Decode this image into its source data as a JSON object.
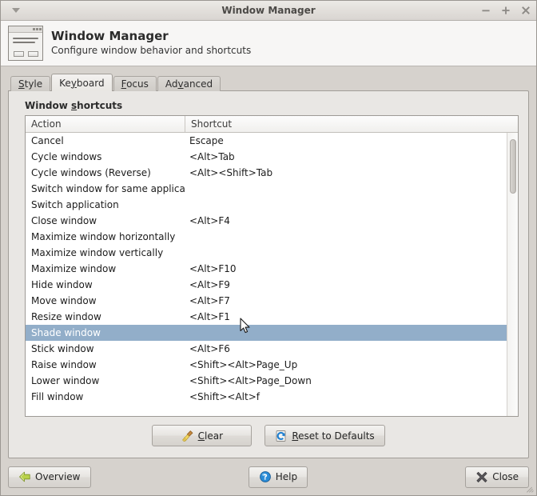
{
  "window": {
    "title": "Window Manager",
    "menu_icon": "chevron-down-icon",
    "minimize_label": "−",
    "maximize_label": "+",
    "close_label": "×"
  },
  "banner": {
    "icon": "window-manager-icon",
    "title": "Window Manager",
    "subtitle": "Configure window behavior and shortcuts"
  },
  "tabs": [
    {
      "label": "Style",
      "mnemonic": "S",
      "active": false
    },
    {
      "label": "Keyboard",
      "mnemonic": "y",
      "active": true
    },
    {
      "label": "Focus",
      "mnemonic": "F",
      "active": false
    },
    {
      "label": "Advanced",
      "mnemonic": "v",
      "active": false
    }
  ],
  "frame": {
    "label_pre": "Window ",
    "label_mnemonic": "s",
    "label_post": "hortcuts"
  },
  "table": {
    "columns": [
      "Action",
      "Shortcut"
    ],
    "selected_index": 12,
    "rows": [
      {
        "action": "Cancel",
        "shortcut": "Escape"
      },
      {
        "action": "Cycle windows",
        "shortcut": "<Alt>Tab"
      },
      {
        "action": "Cycle windows (Reverse)",
        "shortcut": "<Alt><Shift>Tab"
      },
      {
        "action": "Switch window for same application",
        "shortcut": ""
      },
      {
        "action": "Switch application",
        "shortcut": ""
      },
      {
        "action": "Close window",
        "shortcut": "<Alt>F4"
      },
      {
        "action": "Maximize window horizontally",
        "shortcut": ""
      },
      {
        "action": "Maximize window vertically",
        "shortcut": ""
      },
      {
        "action": "Maximize window",
        "shortcut": "<Alt>F10"
      },
      {
        "action": "Hide window",
        "shortcut": "<Alt>F9"
      },
      {
        "action": "Move window",
        "shortcut": "<Alt>F7"
      },
      {
        "action": "Resize window",
        "shortcut": "<Alt>F1"
      },
      {
        "action": "Shade window",
        "shortcut": ""
      },
      {
        "action": "Stick window",
        "shortcut": "<Alt>F6"
      },
      {
        "action": "Raise window",
        "shortcut": "<Shift><Alt>Page_Up"
      },
      {
        "action": "Lower window",
        "shortcut": "<Shift><Alt>Page_Down"
      },
      {
        "action": "Fill window",
        "shortcut": "<Shift><Alt>f"
      }
    ]
  },
  "tree_actions": {
    "clear": {
      "pre": "",
      "mnemonic": "C",
      "post": "lear",
      "icon": "broom-icon"
    },
    "reset": {
      "pre": "",
      "mnemonic": "R",
      "post": "eset to Defaults",
      "icon": "refresh-document-icon"
    }
  },
  "bottom": {
    "overview": {
      "label": "Overview",
      "icon": "back-arrow-icon"
    },
    "help": {
      "label": "Help",
      "icon": "help-icon"
    },
    "close": {
      "label": "Close",
      "icon": "close-x-icon"
    }
  },
  "colors": {
    "selection": "#92aec9",
    "window_bg": "#d6d2cd",
    "page_bg": "#e9e7e4",
    "list_bg": "#ffffff",
    "help_blue": "#2a8bd6",
    "overview_green": "#b4d24a"
  }
}
